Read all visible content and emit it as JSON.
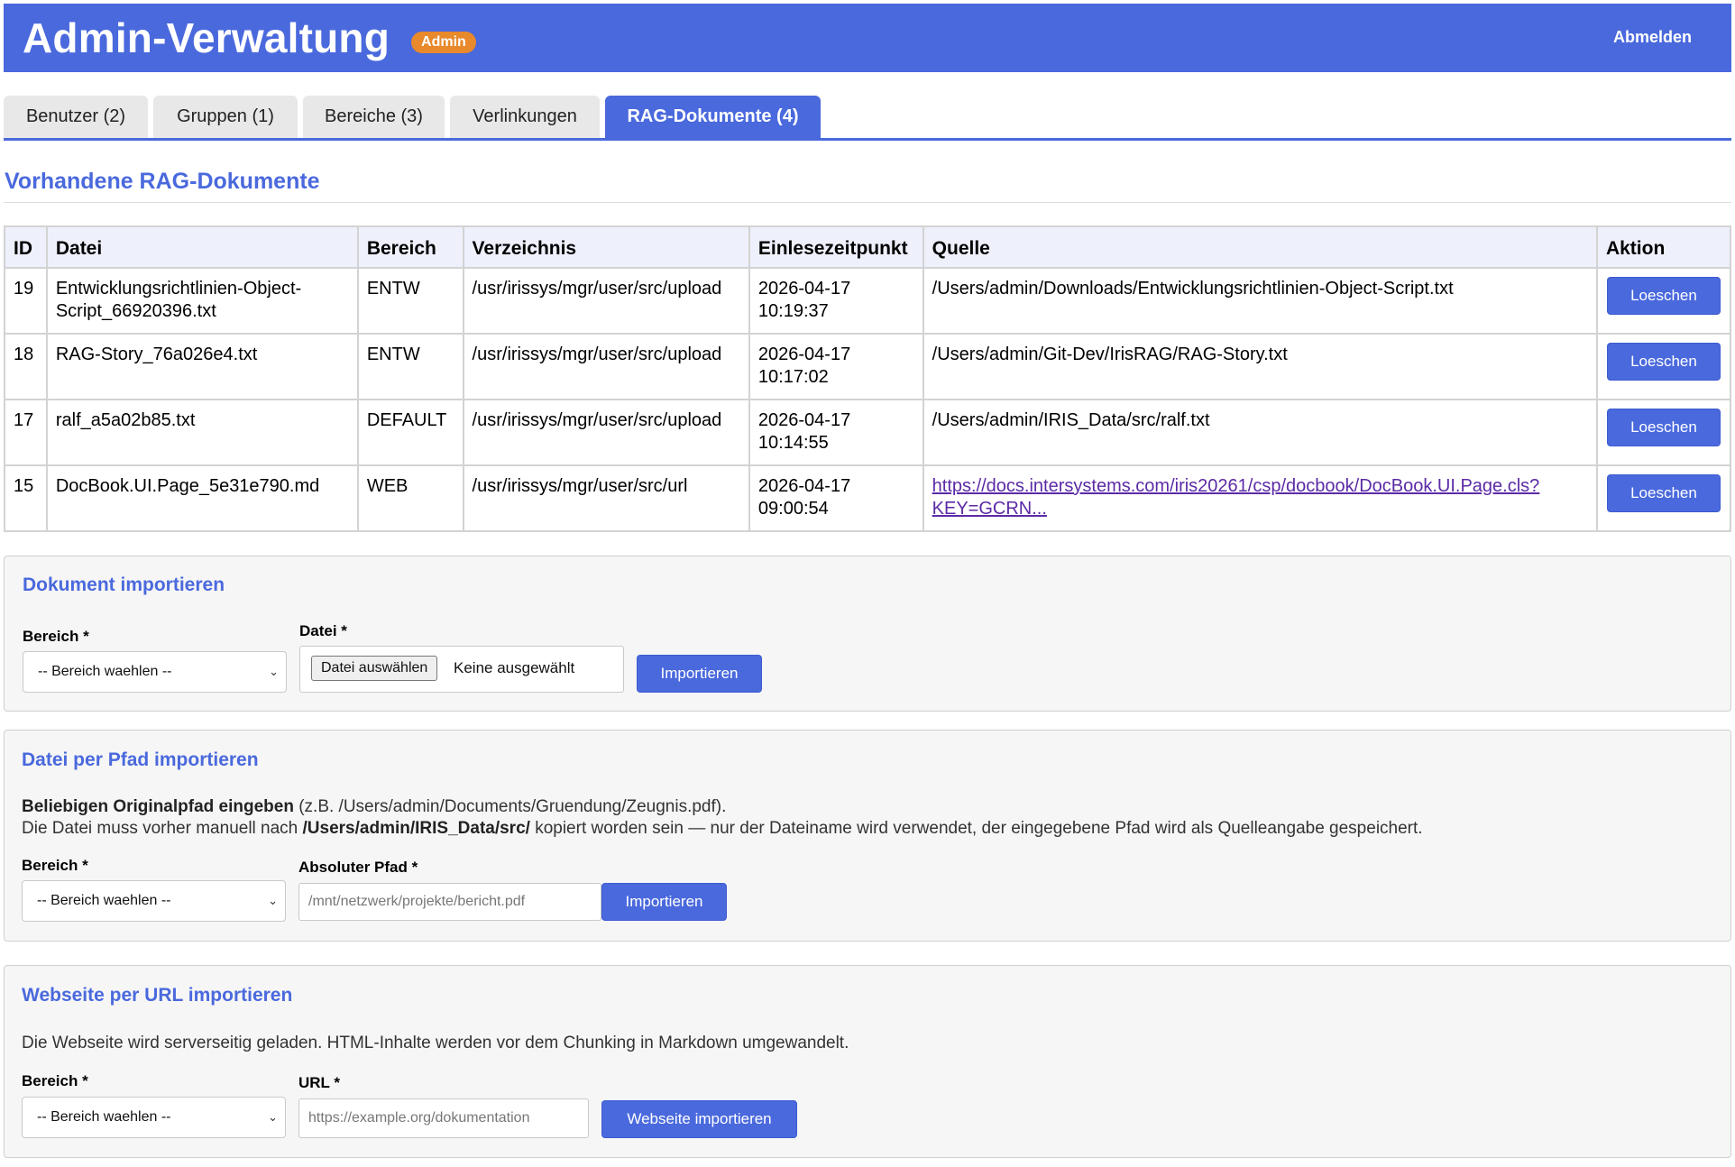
{
  "header": {
    "title": "Admin-Verwaltung",
    "badge": "Admin",
    "logout": "Abmelden"
  },
  "tabs": [
    {
      "label": "Benutzer (2)",
      "active": false
    },
    {
      "label": "Gruppen (1)",
      "active": false
    },
    {
      "label": "Bereiche (3)",
      "active": false
    },
    {
      "label": "Verlinkungen",
      "active": false
    },
    {
      "label": "RAG-Dokumente (4)",
      "active": true
    }
  ],
  "section_title": "Vorhandene RAG-Dokumente",
  "table": {
    "headers": [
      "ID",
      "Datei",
      "Bereich",
      "Verzeichnis",
      "Einlesezeitpunkt",
      "Quelle",
      "Aktion"
    ],
    "rows": [
      {
        "id": "19",
        "datei_1": "Entwicklungsrichtlinien-Object-",
        "datei_2": "Script_66920396.txt",
        "bereich": "ENTW",
        "verzeichnis": "/usr/irissys/mgr/user/src/upload",
        "date": "2026-04-17",
        "time": "10:19:37",
        "quelle_1": "/Users/admin/Downloads/Entwicklungsrichtlinien-Object-Script.txt",
        "quelle_2": "",
        "aktion": "Loeschen"
      },
      {
        "id": "18",
        "datei_1": "RAG-Story_76a026e4.txt",
        "datei_2": "",
        "bereich": "ENTW",
        "verzeichnis": "/usr/irissys/mgr/user/src/upload",
        "date": "2026-04-17",
        "time": "10:17:02",
        "quelle_1": "/Users/admin/Git-Dev/IrisRAG/RAG-Story.txt",
        "quelle_2": "",
        "aktion": "Loeschen"
      },
      {
        "id": "17",
        "datei_1": "ralf_a5a02b85.txt",
        "datei_2": "",
        "bereich": "DEFAULT",
        "verzeichnis": "/usr/irissys/mgr/user/src/upload",
        "date": "2026-04-17",
        "time": "10:14:55",
        "quelle_1": "/Users/admin/IRIS_Data/src/ralf.txt",
        "quelle_2": "",
        "aktion": "Loeschen"
      },
      {
        "id": "15",
        "datei_1": "DocBook.UI.Page_5e31e790.md",
        "datei_2": "",
        "bereich": "WEB",
        "verzeichnis": "/usr/irissys/mgr/user/src/url",
        "date": "2026-04-17",
        "time": "09:00:54",
        "quelle_1": "https://docs.intersystems.com/iris20261/csp/docbook/DocBook.UI.Page.cls?",
        "quelle_2": "KEY=GCRN...",
        "aktion": "Loeschen"
      }
    ]
  },
  "import_doc": {
    "title": "Dokument importieren",
    "bereich_label": "Bereich *",
    "bereich_value": "-- Bereich waehlen --",
    "datei_label": "Datei *",
    "file_button": "Datei auswählen",
    "file_status": "Keine ausgewählt",
    "submit": "Importieren"
  },
  "import_path": {
    "title": "Datei per Pfad importieren",
    "desc_bold_1": "Beliebigen Originalpfad eingeben",
    "desc_rest_1": " (z.B. /Users/admin/Documents/Gruendung/Zeugnis.pdf).",
    "desc_pre_2": "Die Datei muss vorher manuell nach ",
    "desc_bold_2": "/Users/admin/IRIS_Data/src/",
    "desc_rest_2": " kopiert worden sein — nur der Dateiname wird verwendet, der eingegebene Pfad wird als Quelleangabe gespeichert.",
    "bereich_label": "Bereich *",
    "bereich_value": "-- Bereich waehlen --",
    "path_label": "Absoluter Pfad *",
    "path_placeholder": "/mnt/netzwerk/projekte/bericht.pdf",
    "submit": "Importieren"
  },
  "import_url": {
    "title": "Webseite per URL importieren",
    "desc": "Die Webseite wird serverseitig geladen. HTML-Inhalte werden vor dem Chunking in Markdown umgewandelt.",
    "bereich_label": "Bereich *",
    "bereich_value": "-- Bereich waehlen --",
    "url_label": "URL *",
    "url_placeholder": "https://example.org/dokumentation",
    "submit": "Webseite importieren"
  },
  "colors": {
    "primary": "#4a69dd",
    "badge": "#e8892b",
    "link": "#5b2aa6"
  }
}
